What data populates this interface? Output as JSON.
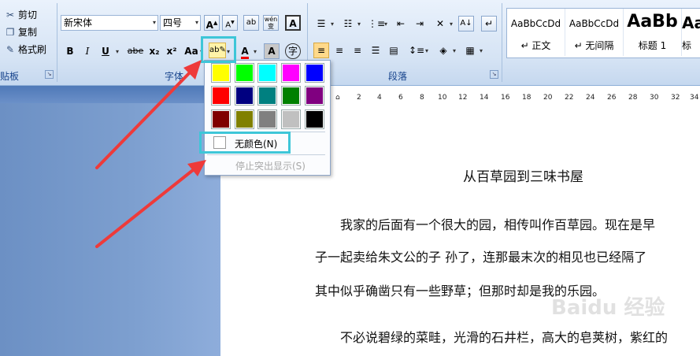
{
  "clipboard": {
    "cut": "剪切",
    "copy": "复制",
    "format_painter": "格式刷",
    "label": "贴板"
  },
  "font": {
    "name": "新宋体",
    "size": "四号",
    "label": "字体",
    "bold": "B",
    "italic": "I",
    "underline": "U",
    "strike": "abe",
    "subscript": "x₂",
    "superscript": "x²",
    "change_case": "Aa",
    "grow": "A",
    "shrink": "A",
    "phonetic": "wén"
  },
  "paragraph": {
    "label": "段落"
  },
  "styles": [
    {
      "sample": "AaBbCcDd",
      "name": "↵ 正文"
    },
    {
      "sample": "AaBbCcDd",
      "name": "↵ 无间隔"
    },
    {
      "sample": "AaBb",
      "name": "标题 1"
    },
    {
      "sample": "Aa",
      "name": "标"
    }
  ],
  "highlight_menu": {
    "colors": [
      "#ffff00",
      "#00ff00",
      "#00ffff",
      "#ff00ff",
      "#0000ff",
      "#ff0000",
      "#000080",
      "#008080",
      "#008000",
      "#800080",
      "#800000",
      "#808000",
      "#808080",
      "#c0c0c0",
      "#000000"
    ],
    "no_color": "无颜色(N)",
    "stop_highlight": "停止突出显示(S)"
  },
  "ruler": {
    "ticks": [
      "2",
      "4",
      "6",
      "8",
      "10",
      "12",
      "14",
      "16",
      "18",
      "20",
      "22",
      "24",
      "26",
      "28",
      "30",
      "32",
      "34"
    ]
  },
  "document": {
    "title": "从百草园到三味书屋",
    "lines": [
      "我家的后面有一个很大的园，相传叫作百草园。现在是早",
      "子一起卖给朱文公的子 孙了，连那最末次的相见也已经隔了",
      "其中似乎确凿只有一些野草；但那时却是我的乐园。",
      "不必说碧绿的菜畦，光滑的石井栏，高大的皂荚树，紫红的"
    ]
  },
  "watermark": "Baidu 经验"
}
